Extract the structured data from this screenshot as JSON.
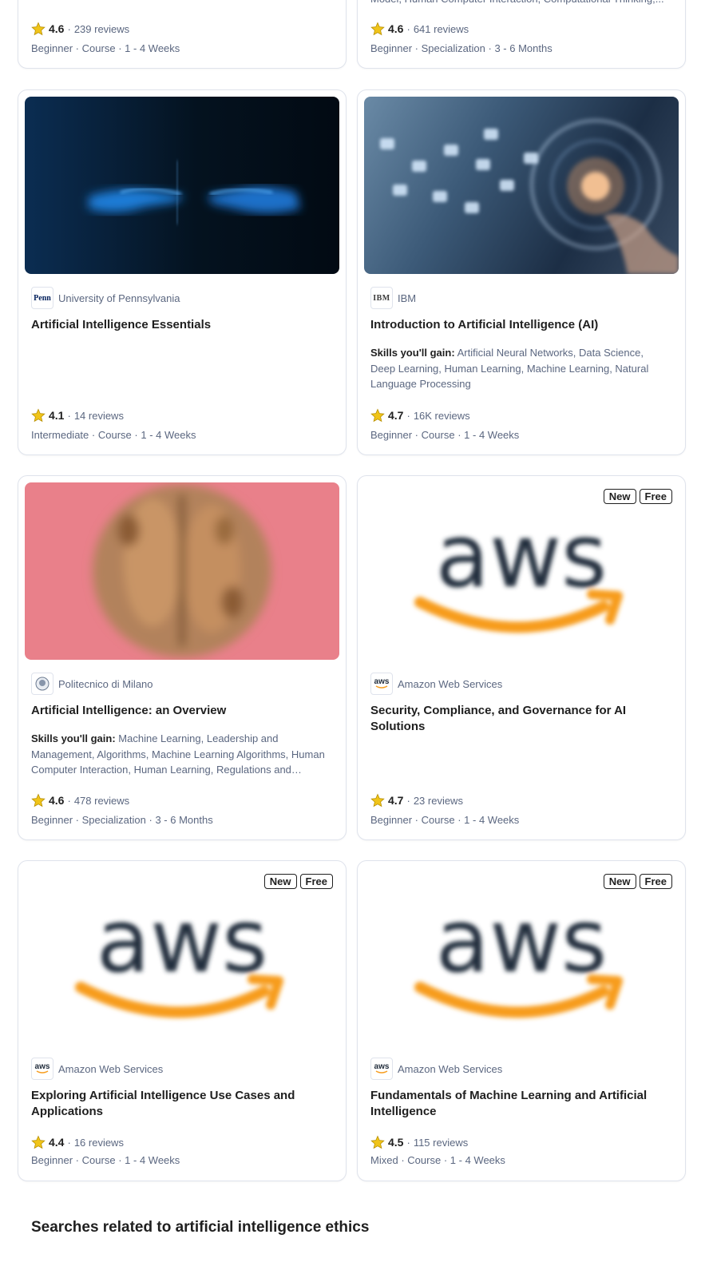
{
  "cards": [
    {
      "rating": "4.6",
      "reviews": "239 reviews",
      "level": "Beginner",
      "type": "Course",
      "duration": "1 - 4 Weeks"
    },
    {
      "skills_tail": "Model, Human Computer Interaction, Computational Thinking,...",
      "rating": "4.6",
      "reviews": "641 reviews",
      "level": "Beginner",
      "type": "Specialization",
      "duration": "3 - 6 Months"
    },
    {
      "partner": "University of Pennsylvania",
      "partner_logo": "Penn",
      "title": "Artificial Intelligence Essentials",
      "rating": "4.1",
      "reviews": "14 reviews",
      "level": "Intermediate",
      "type": "Course",
      "duration": "1 - 4 Weeks",
      "image": "blue-hands-touching"
    },
    {
      "partner": "IBM",
      "partner_logo": "IBM",
      "title": "Introduction to Artificial Intelligence (AI)",
      "skills_label": "Skills you'll gain:",
      "skills": "Artificial Neural Networks, Data Science, Deep Learning, Human Learning, Machine Learning, Natural Language Processing",
      "rating": "4.7",
      "reviews": "16K reviews",
      "level": "Beginner",
      "type": "Course",
      "duration": "1 - 4 Weeks",
      "image": "digital-globe-hand"
    },
    {
      "partner": "Politecnico di Milano",
      "partner_logo": "seal",
      "title": "Artificial Intelligence: an Overview",
      "skills_label": "Skills you'll gain:",
      "skills": "Machine Learning, Leadership and Management, Algorithms, Machine Learning Algorithms, Human Computer Interaction, Human Learning, Regulations and Compliance",
      "rating": "4.6",
      "reviews": "478 reviews",
      "level": "Beginner",
      "type": "Specialization",
      "duration": "3 - 6 Months",
      "image": "walnut-on-pink"
    },
    {
      "partner": "Amazon Web Services",
      "partner_logo": "aws",
      "title": "Security, Compliance, and Governance for AI Solutions",
      "badges": [
        "New",
        "Free"
      ],
      "rating": "4.7",
      "reviews": "23 reviews",
      "level": "Beginner",
      "type": "Course",
      "duration": "1 - 4 Weeks",
      "image": "aws-logo",
      "image_text": "aws"
    },
    {
      "partner": "Amazon Web Services",
      "partner_logo": "aws",
      "title": "Exploring Artificial Intelligence Use Cases and Applications",
      "badges": [
        "New",
        "Free"
      ],
      "rating": "4.4",
      "reviews": "16 reviews",
      "level": "Beginner",
      "type": "Course",
      "duration": "1 - 4 Weeks",
      "image": "aws-logo",
      "image_text": "aws"
    },
    {
      "partner": "Amazon Web Services",
      "partner_logo": "aws",
      "title": "Fundamentals of Machine Learning and Artificial Intelligence",
      "badges": [
        "New",
        "Free"
      ],
      "rating": "4.5",
      "reviews": "115 reviews",
      "level": "Mixed",
      "type": "Course",
      "duration": "1 - 4 Weeks",
      "image": "aws-logo",
      "image_text": "aws"
    }
  ],
  "separator": "·",
  "related_heading": "Searches related to artificial intelligence ethics",
  "colors": {
    "star": "#f0c419",
    "text": "#1f1f1f",
    "muted": "#5b6780",
    "border": "#dfe3ec",
    "aws_orange": "#f79c1d"
  }
}
